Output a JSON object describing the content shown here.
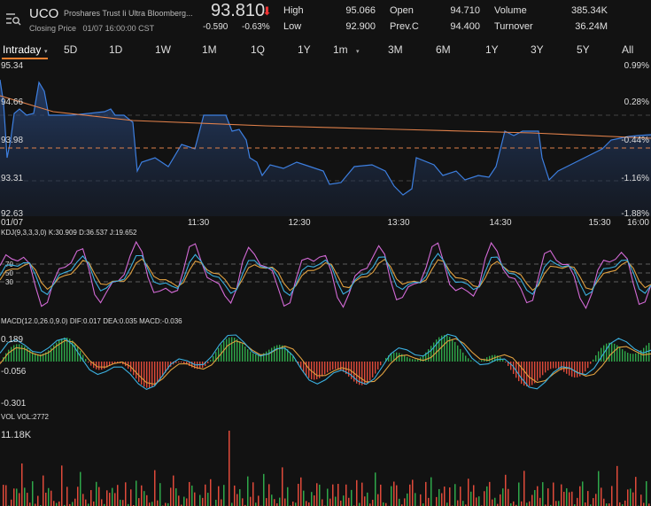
{
  "header": {
    "ticker": "UCO",
    "name": "Proshares Trust Ii Ultra Bloomberg...",
    "closing_label": "Closing Price",
    "closing_time": "01/07 16:00:00 CST",
    "price": "93.810",
    "change": "-0.590",
    "change_pct": "-0.63%",
    "high_label": "High",
    "high": "95.066",
    "low_label": "Low",
    "low": "92.900",
    "open_label": "Open",
    "open": "94.710",
    "prevc_label": "Prev.C",
    "prevc": "94.400",
    "volume_label": "Volume",
    "volume": "385.34K",
    "turnover_label": "Turnover",
    "turnover": "36.24M",
    "down_color": "#e53935"
  },
  "tabs": [
    "Intraday",
    "5D",
    "1D",
    "1W",
    "1M",
    "1Q",
    "1Y",
    "1m",
    "3M",
    "6M",
    "1Y",
    "3Y",
    "5Y",
    "All"
  ],
  "price_chart": {
    "y_labels": [
      "95.34",
      "94.66",
      "93.98",
      "93.31",
      "92.63"
    ],
    "pct_labels": [
      "0.99%",
      "0.28%",
      "-0.44%",
      "-1.16%",
      "-1.88%"
    ],
    "x_labels": [
      "01/07",
      "11:30",
      "12:30",
      "13:30",
      "14:30",
      "15:30",
      "16:00"
    ],
    "line_color": "#3d7fe0",
    "avg_color": "#e0804a"
  },
  "kdj": {
    "label": "KDJ(9,3,3,3,0)",
    "k": "K:30.909",
    "d": "D:36.537",
    "j": "J:19.652",
    "levels": [
      "70",
      "50",
      "30"
    ]
  },
  "macd": {
    "label": "MACD(12.0,26.0,9.0)",
    "dif": "DIF:0.017",
    "dea": "DEA:0.035",
    "macd": "MACD:-0.036",
    "top": "0.189",
    "mid": "-0.056",
    "bottom": "-0.301"
  },
  "vol": {
    "label": "VOL",
    "value": "VOL:2772",
    "max": "11.18K"
  }
}
